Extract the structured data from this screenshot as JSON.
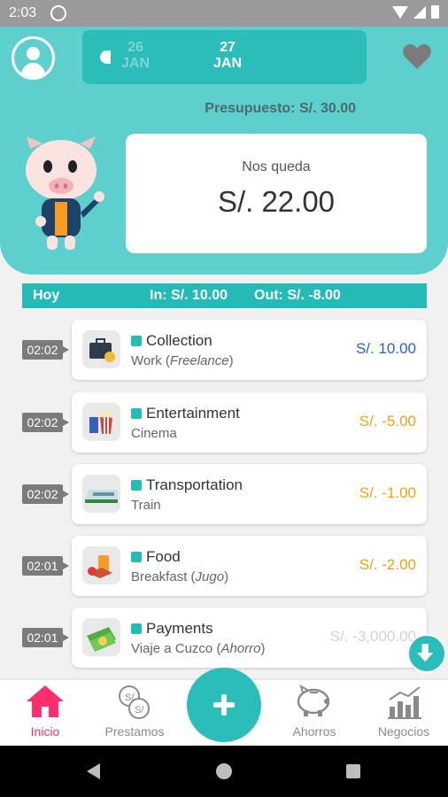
{
  "status_bar": {
    "time": "2:03"
  },
  "header": {
    "prev_date": {
      "day": "26",
      "month": "JAN"
    },
    "current_date": {
      "day": "27",
      "month": "JAN"
    },
    "budget": "Presupuesto: S/. 30.00",
    "remaining_label": "Nos queda",
    "remaining_amount": "S/. 22.00"
  },
  "summary": {
    "day": "Hoy",
    "in": "In: S/. 10.00",
    "out": "Out: S/. -8.00"
  },
  "transactions": [
    {
      "time": "02:02",
      "icon": "briefcase-icon",
      "category": "Collection",
      "sub": "Work",
      "note": "Freelance",
      "amount": "S/. 10.00",
      "type": "in"
    },
    {
      "time": "02:02",
      "icon": "popcorn-icon",
      "category": "Entertainment",
      "sub": "Cinema",
      "note": "",
      "amount": "S/. -5.00",
      "type": "out"
    },
    {
      "time": "02:02",
      "icon": "train-icon",
      "category": "Transportation",
      "sub": "Train",
      "note": "",
      "amount": "S/. -1.00",
      "type": "out"
    },
    {
      "time": "02:01",
      "icon": "breakfast-icon",
      "category": "Food",
      "sub": "Breakfast",
      "note": "Jugo",
      "amount": "S/. -2.00",
      "type": "out"
    },
    {
      "time": "02:01",
      "icon": "money-icon",
      "category": "Payments",
      "sub": "Viaje a Cuzco",
      "note": "Ahorro",
      "amount": "S/. -3,000.00",
      "type": "faded"
    }
  ],
  "bottom_nav": {
    "items": [
      {
        "label": "Inicio",
        "icon": "home-icon",
        "active": true
      },
      {
        "label": "Prestamos",
        "icon": "coins-icon",
        "active": false
      },
      {
        "label": "Ahorros",
        "icon": "piggy-bank-icon",
        "active": false
      },
      {
        "label": "Negocios",
        "icon": "bar-chart-icon",
        "active": false
      }
    ]
  },
  "colors": {
    "accent": "#2bbdb9",
    "header": "#5dcfcd",
    "in": "#2a62d1",
    "out": "#f0a11a",
    "active_nav": "#ff2f6e"
  }
}
